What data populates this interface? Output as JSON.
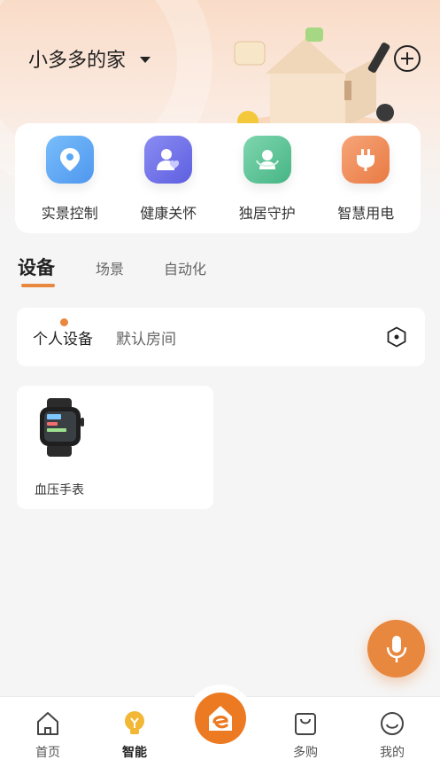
{
  "header": {
    "home_name": "小多多的家",
    "icons": {
      "dropdown": "caret-down-icon",
      "add": "plus-circle-icon"
    }
  },
  "quick_actions": [
    {
      "label": "实景控制",
      "icon": "location-pin-icon",
      "color": "#5aa9f5"
    },
    {
      "label": "健康关怀",
      "icon": "person-heart-icon",
      "color": "#6d6ee8"
    },
    {
      "label": "独居守护",
      "icon": "guard-person-icon",
      "color": "#5bc394"
    },
    {
      "label": "智慧用电",
      "icon": "plug-icon",
      "color": "#ef8a55"
    }
  ],
  "tabs": [
    {
      "label": "设备",
      "active": true
    },
    {
      "label": "场景",
      "active": false
    },
    {
      "label": "自动化",
      "active": false
    }
  ],
  "rooms": {
    "items": [
      {
        "label": "个人设备",
        "active": true
      },
      {
        "label": "默认房间",
        "active": false
      }
    ],
    "settings_icon": "hexagon-settings-icon"
  },
  "devices": [
    {
      "name": "血压手表",
      "icon": "smartwatch-icon"
    }
  ],
  "voice_button": {
    "icon": "microphone-icon"
  },
  "bottom_nav": [
    {
      "label": "首页",
      "icon": "home-icon",
      "active": false
    },
    {
      "label": "智能",
      "icon": "lightbulb-icon",
      "active": true
    },
    {
      "label": "",
      "icon": "center-logo-icon",
      "active": false
    },
    {
      "label": "多购",
      "icon": "shopping-bag-icon",
      "active": false
    },
    {
      "label": "我的",
      "icon": "smile-icon",
      "active": false
    }
  ],
  "colors": {
    "accent": "#e8873e",
    "background": "#f5f5f5",
    "header_gradient_top": "#f9dcc8"
  }
}
